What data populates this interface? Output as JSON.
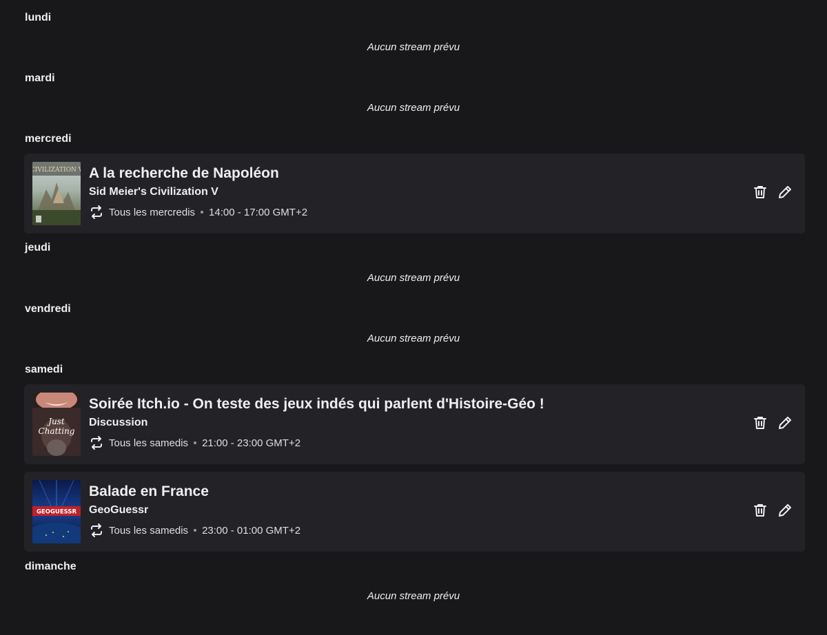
{
  "days": [
    {
      "name": "lundi",
      "empty_text": "Aucun stream prévu"
    },
    {
      "name": "mardi",
      "empty_text": "Aucun stream prévu"
    },
    {
      "name": "mercredi"
    },
    {
      "name": "jeudi",
      "empty_text": "Aucun stream prévu"
    },
    {
      "name": "vendredi",
      "empty_text": "Aucun stream prévu"
    },
    {
      "name": "samedi"
    },
    {
      "name": "dimanche",
      "empty_text": "Aucun stream prévu"
    }
  ],
  "segments": [
    {
      "title": "A la recherche de Napoléon",
      "category": "Sid Meier's Civilization V",
      "recurrence": "Tous les mercredis",
      "time": "14:00 - 17:00 GMT+2",
      "thumb_text": "CIVILIZATION V"
    },
    {
      "title": "Soirée Itch.io - On teste des jeux indés qui parlent d'Histoire-Géo !",
      "category": "Discussion",
      "recurrence": "Tous les samedis",
      "time": "21:00 - 23:00 GMT+2",
      "thumb_text": "Just Chatting"
    },
    {
      "title": "Balade en France",
      "category": "GeoGuessr",
      "recurrence": "Tous les samedis",
      "time": "23:00 - 01:00 GMT+2",
      "thumb_text": "GEOGUESSR"
    }
  ],
  "colors": {
    "background": "#18181b",
    "card": "#232327",
    "text": "#efeff1"
  },
  "icons": {
    "repeat": "repeat-icon",
    "delete": "trash-icon",
    "edit": "pencil-icon"
  }
}
